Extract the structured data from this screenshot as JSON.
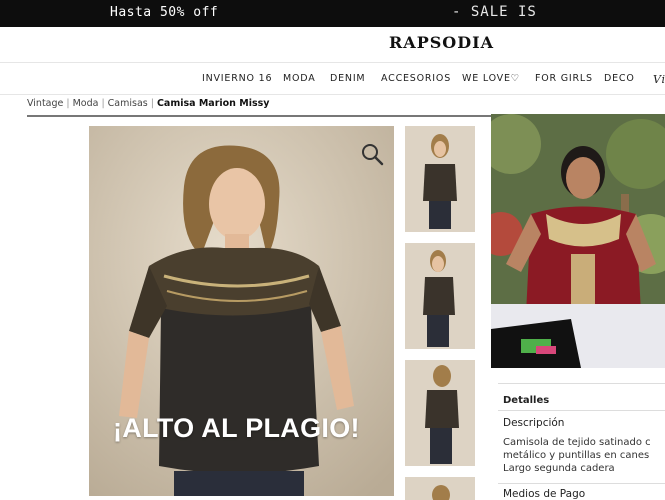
{
  "promo": {
    "left_text": "Hasta 50% off",
    "right_text": "- SALE IS"
  },
  "header": {
    "logo": "RAPSODIA"
  },
  "nav": {
    "items": [
      "INVIERNO 16",
      "MODA",
      "DENIM",
      "ACCESORIOS",
      "WE LOVE♡",
      "FOR GIRLS",
      "DECO",
      "Vi"
    ]
  },
  "breadcrumb": {
    "items": [
      "Vintage",
      "Moda",
      "Camisas"
    ],
    "current": "Camisa Marion Missy",
    "separator": "|"
  },
  "product": {
    "overlay_text": "¡ALTO AL PLAGIO!",
    "zoom_icon": "search-icon"
  },
  "details": {
    "section_title": "Detalles",
    "description_title": "Descripción",
    "description_lines": [
      "Camisola de tejido satinado c",
      "metálico y puntillas en canes",
      "Largo segunda cadera"
    ],
    "payment_title": "Medios de Pago"
  },
  "colors": {
    "promo_bg": "#0d0d0d",
    "brand": "#111111"
  }
}
